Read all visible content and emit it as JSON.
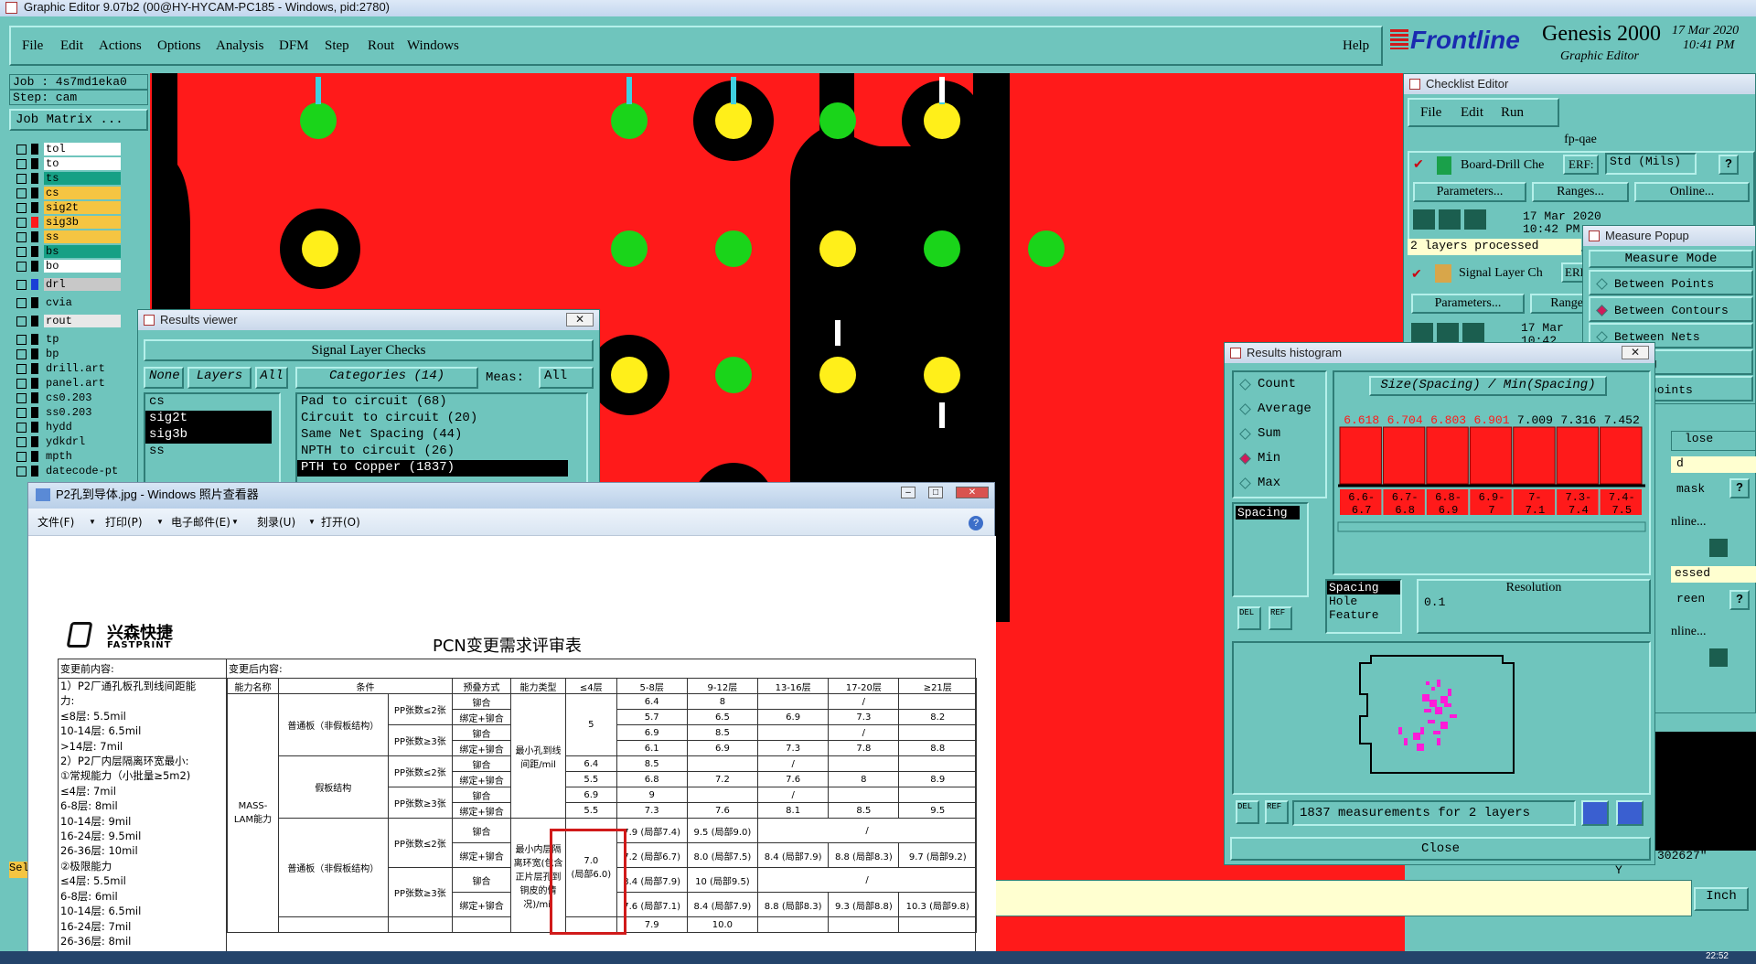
{
  "window": {
    "title": "Graphic Editor 9.07b2 (00@HY-HYCAM-PC185 - Windows, pid:2780)"
  },
  "menu": [
    "File",
    "Edit",
    "Actions",
    "Options",
    "Analysis",
    "DFM",
    "Step",
    "Rout",
    "Windows"
  ],
  "help_label": "Help",
  "brand": {
    "logo": "Frontline",
    "product": "Genesis 2000",
    "subtitle": "Graphic Editor",
    "date": "17 Mar 2020",
    "time": "10:41 PM"
  },
  "left_panel": {
    "job": "Job : 4s7md1eka0",
    "step": "Step: cam",
    "job_matrix": "Job Matrix ..."
  },
  "layers": [
    {
      "name": "tol",
      "color": "#ffffff",
      "sw": "#000000"
    },
    {
      "name": "to",
      "color": "#ffffff",
      "sw": "#000000"
    },
    {
      "name": "ts",
      "color": "#16a085",
      "sw": "#000000"
    },
    {
      "name": "cs",
      "color": "#f5c542",
      "sw": "#000000"
    },
    {
      "name": "sig2t",
      "color": "#f5c542",
      "sw": "#000000"
    },
    {
      "name": "sig3b",
      "color": "#f5c542",
      "sw": "#ff1a1a"
    },
    {
      "name": "ss",
      "color": "#f5c542",
      "sw": "#000000"
    },
    {
      "name": "bs",
      "color": "#16a085",
      "sw": "#000000"
    },
    {
      "name": "bo",
      "color": "#ffffff",
      "sw": "#000000"
    },
    {
      "name": "drl",
      "color": "#c8c8c8",
      "sw": "#1a3fd6"
    },
    {
      "name": "cvia",
      "color": "#6fc5bd",
      "sw": "#000000"
    },
    {
      "name": "rout",
      "color": "#e8e8e8",
      "sw": "#000000"
    },
    {
      "name": "tp",
      "color": "#6fc5bd",
      "sw": "#000000"
    },
    {
      "name": "bp",
      "color": "#6fc5bd",
      "sw": "#000000"
    },
    {
      "name": "drill.art",
      "color": "#6fc5bd",
      "sw": "#000000"
    },
    {
      "name": "panel.art",
      "color": "#6fc5bd",
      "sw": "#000000"
    },
    {
      "name": "cs0.203",
      "color": "#6fc5bd",
      "sw": "#000000"
    },
    {
      "name": "ss0.203",
      "color": "#6fc5bd",
      "sw": "#000000"
    },
    {
      "name": "hydd",
      "color": "#6fc5bd",
      "sw": "#000000"
    },
    {
      "name": "ydkdrl",
      "color": "#6fc5bd",
      "sw": "#000000"
    },
    {
      "name": "mpth",
      "color": "#6fc5bd",
      "sw": "#000000"
    },
    {
      "name": "datecode-pt",
      "color": "#6fc5bd",
      "sw": "#000000"
    }
  ],
  "results_viewer": {
    "title": "Results viewer",
    "header": "Signal Layer Checks",
    "none_btn": "None",
    "layers_btn": "Layers",
    "all_btn": "All",
    "categories_btn": "Categories (14)",
    "meas_label": "Meas:",
    "meas_value": "All",
    "layer_items": [
      "cs",
      "sig2t",
      "sig3b",
      "ss"
    ],
    "selected_layers": [
      "sig2t",
      "sig3b"
    ],
    "categories": [
      "Pad to circuit (68)",
      "Circuit to circuit (20)",
      "Same Net Spacing (44)",
      "NPTH to circuit (26)",
      "PTH to Copper (1837)"
    ],
    "selected_category": "PTH to Copper (1837)"
  },
  "checklist": {
    "title": "Checklist Editor",
    "menu": [
      "File",
      "Edit",
      "Run"
    ],
    "name": "fp-qae",
    "board_drill_label": "Board-Drill Che",
    "erf_label": "ERF:",
    "erf_value": "Std (Mils)",
    "parameters": "Parameters...",
    "ranges": "Ranges...",
    "online": "Online...",
    "run_date": "17 Mar 2020",
    "run_time": "10:42 PM",
    "status": "2 layers processed",
    "signal_layer_label": "Signal Layer Ch",
    "erf_short": "ERF",
    "ranges_short": "Range",
    "run_date2": "17 Mar",
    "run_time2": "10:42",
    "side_fragments": [
      "lose",
      "d",
      "mask",
      "nline...",
      "essed",
      "reen",
      "nline..."
    ]
  },
  "measure_popup": {
    "title": "Measure Popup",
    "mode_label": "Measure Mode",
    "options": [
      "Between Points",
      "Between Contours",
      "Between Nets",
      "c Ring",
      "n Midpoints"
    ],
    "selected": "Between Contours"
  },
  "histogram": {
    "title": "Results histogram",
    "modes": [
      "Count",
      "Average",
      "Sum",
      "Min",
      "Max"
    ],
    "selected_mode": "Min",
    "heading": "Size(Spacing) / Min(Spacing)",
    "field_list": [
      "Spacing"
    ],
    "attribute_list": [
      "Spacing",
      "Hole",
      "Feature"
    ],
    "resolution_label": "Resolution",
    "resolution_value": "0.1",
    "status": "1837 measurements for 2 layers",
    "close": "Close",
    "del_label": "DEL",
    "ref_label": "REF"
  },
  "chart_data": {
    "type": "bar",
    "title": "Size(Spacing) / Min(Spacing)",
    "categories": [
      "6.6-6.7",
      "6.7-6.8",
      "6.8-6.9",
      "6.9-7",
      "7-7.1",
      "7.3-7.4",
      "7.4-7.5"
    ],
    "values": [
      6.618,
      6.704,
      6.803,
      6.901,
      7.009,
      7.316,
      7.452
    ],
    "xlabel": "",
    "ylabel": ""
  },
  "photo_viewer": {
    "title": "P2孔到导体.jpg - Windows 照片查看器",
    "menu": [
      "文件(F)",
      "打印(P)",
      "电子邮件(E)",
      "刻录(U)",
      "打开(O)"
    ],
    "logo_cn": "兴森快捷",
    "logo_en": "FASTPRINT",
    "doc_title": "PCN变更需求评审表",
    "before_label": "变更前内容:",
    "after_label": "变更后内容:",
    "before_lines": [
      "1）P2厂通孔板孔到线间距能",
      "力:",
      "≤8层: 5.5mil",
      "10-14层: 6.5mil",
      ">14层: 7mil",
      "2）P2厂内层隔离环宽最小:",
      "①常规能力（小批量≥5m2)",
      "≤4层: 7mil",
      "6-8层: 8mil",
      "10-14层: 9mil",
      "16-24层: 9.5mil",
      "26-36层: 10mil",
      "②极限能力",
      "≤4层: 5.5mil",
      "6-8层: 6mil",
      "10-14层: 6.5mil",
      "16-24层: 7mil",
      "26-36层: 8mil"
    ],
    "table_headers": [
      "能力名称",
      "条件",
      "",
      "预叠方式",
      "能力类型",
      "≤4层",
      "5-8层",
      "9-12层",
      "13-16层",
      "17-20层",
      "≥21层"
    ],
    "cells": {
      "mass_lam": "MASS-LAM能力",
      "normal_board": "普通板（非假板结构）",
      "fake_board": "假板结构",
      "pp_le2": "PP张数≤2张",
      "pp_ge3": "PP张数≥3张",
      "rivet": "铆合",
      "bind_rivet": "绑定+铆合",
      "type1": "最小孔到线间距/mil",
      "type2": "最小内层隔离环宽(包含正片层孔到铜皮的情况)/mil",
      "slash": "/",
      "v5": "5",
      "highlight": "7.0",
      "highlight_sub": "(局部6.0)"
    },
    "rows_a": [
      [
        "6.4",
        "8",
        "",
        "/",
        ""
      ],
      [
        "5.7",
        "6.5",
        "6.9",
        "7.3",
        "8.2"
      ],
      [
        "6.9",
        "8.5",
        "",
        "/",
        ""
      ],
      [
        "6.1",
        "6.9",
        "7.3",
        "7.8",
        "8.8"
      ]
    ],
    "rows_b": [
      [
        "6.4",
        "8.5",
        "",
        "/",
        ""
      ],
      [
        "5.5",
        "6.8",
        "7.2",
        "7.6",
        "8",
        "8.9"
      ],
      [
        "6.9",
        "9",
        "",
        "/",
        ""
      ],
      [
        "5.5",
        "7.3",
        "7.6",
        "8.1",
        "8.5",
        "9.5"
      ]
    ],
    "rows_c": [
      [
        "7.9 (局部7.4)",
        "9.5 (局部9.0)",
        "/"
      ],
      [
        "7.2 (局部6.7)",
        "8.0 (局部7.5)",
        "8.4 (局部7.9)",
        "8.8 (局部8.3)",
        "9.7 (局部9.2)"
      ],
      [
        "8.4 (局部7.9)",
        "10 (局部9.5)",
        "/"
      ],
      [
        "7.6 (局部7.1)",
        "8.4 (局部7.9)",
        "8.8 (局部8.3)",
        "9.3 (局部8.8)",
        "10.3 (局部9.8)"
      ]
    ],
    "row_d": [
      "7.9",
      "10.0"
    ]
  },
  "bottom": {
    "units": "Inch",
    "coord": "302627\"",
    "y_label": "Y",
    "sel_label": "Sel"
  },
  "taskbar_time": "22:52"
}
